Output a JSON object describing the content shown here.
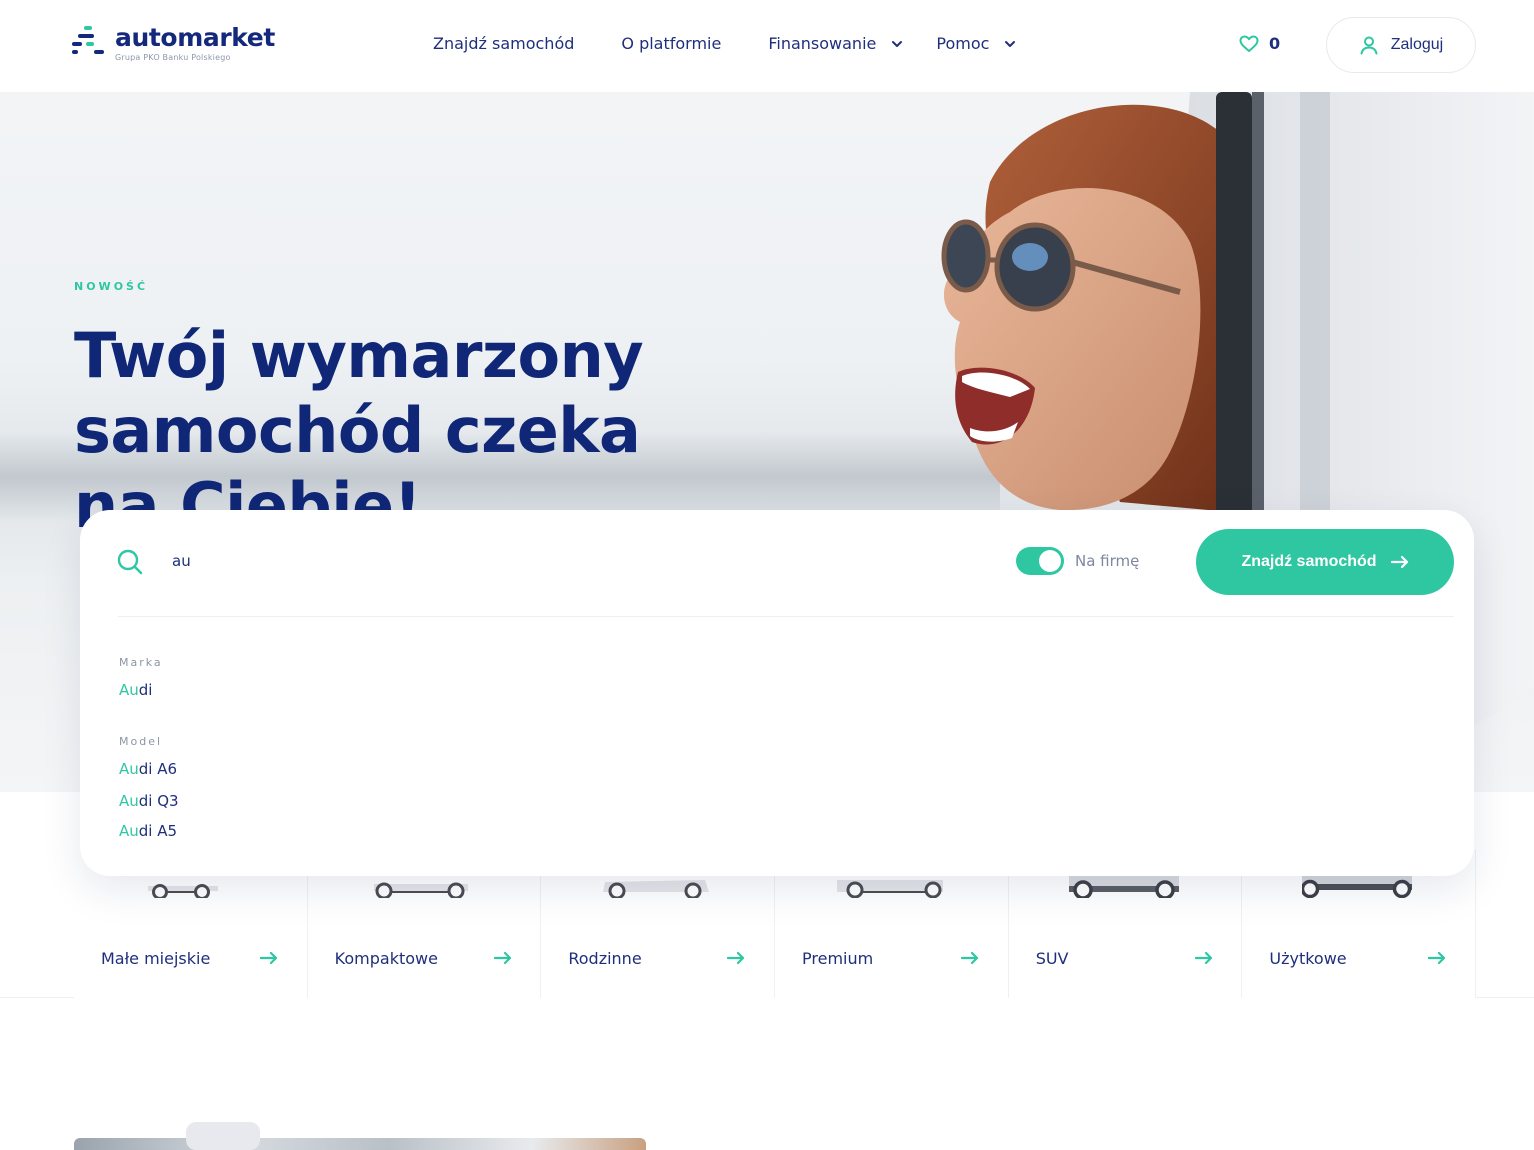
{
  "brand": {
    "name": "automarket",
    "tagline": "Grupa PKO Banku Polskiego"
  },
  "nav": {
    "items": [
      {
        "label": "Znajdź samochód",
        "dropdown": false
      },
      {
        "label": "O platformie",
        "dropdown": false
      },
      {
        "label": "Finansowanie",
        "dropdown": true
      },
      {
        "label": "Pomoc",
        "dropdown": true
      }
    ],
    "favorites_count": "0",
    "login_label": "Zaloguj"
  },
  "hero": {
    "kicker": "NOWOŚĆ",
    "headline_line1": "Twój wymarzony",
    "headline_line2": "samochód czeka",
    "headline_line3a": "na ",
    "headline_line3b": "Ciebie!"
  },
  "search": {
    "value": "au",
    "toggle_label": "Na firmę",
    "toggle_on": true,
    "button_label": "Znajdź samochód",
    "groups": {
      "brand_label": "Marka",
      "model_label": "Model"
    },
    "brand_suggestions": [
      {
        "match": "Au",
        "rest": "di"
      }
    ],
    "model_suggestions": [
      {
        "match": "Au",
        "rest": "di A6"
      },
      {
        "match": "Au",
        "rest": "di Q3"
      },
      {
        "match": "Au",
        "rest": "di A5"
      }
    ]
  },
  "categories": [
    {
      "label": "Małe miejskie",
      "icon": "small-car-icon"
    },
    {
      "label": "Kompaktowe",
      "icon": "compact-car-icon"
    },
    {
      "label": "Rodzinne",
      "icon": "family-car-icon"
    },
    {
      "label": "Premium",
      "icon": "premium-car-icon"
    },
    {
      "label": "SUV",
      "icon": "suv-icon"
    },
    {
      "label": "Użytkowe",
      "icon": "van-icon"
    }
  ],
  "colors": {
    "accent": "#2ec7a2",
    "primary": "#0f2776",
    "text": "#1f2f7d",
    "muted": "#8d94a5"
  }
}
